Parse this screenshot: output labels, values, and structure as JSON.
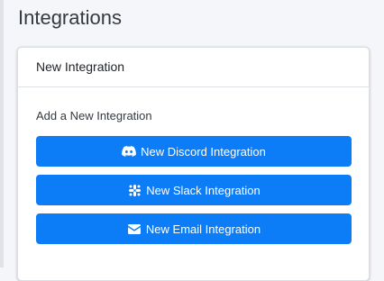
{
  "page": {
    "title": "Integrations"
  },
  "card": {
    "header": "New Integration",
    "section_label": "Add a New Integration",
    "buttons": [
      {
        "label": "New Discord Integration",
        "icon": "discord-icon"
      },
      {
        "label": "New Slack Integration",
        "icon": "slack-icon"
      },
      {
        "label": "New Email Integration",
        "icon": "envelope-icon"
      }
    ]
  },
  "colors": {
    "primary": "#0d7cf7",
    "background": "#f4f6f9",
    "card": "#ffffff"
  }
}
